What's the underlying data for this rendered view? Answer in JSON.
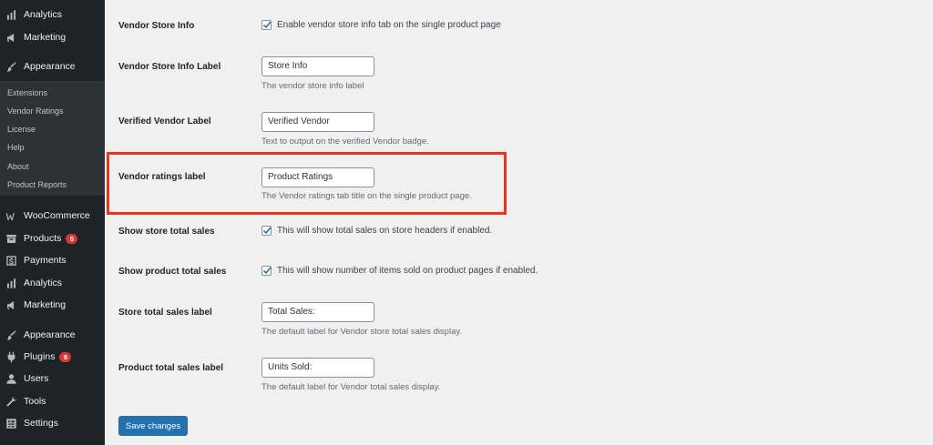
{
  "sidebar": {
    "items": [
      {
        "label": "Analytics",
        "icon": "analytics-icon"
      },
      {
        "label": "Marketing",
        "icon": "megaphone-icon"
      },
      {
        "label": "Appearance",
        "icon": "paintbrush-icon"
      },
      {
        "label": "WooCommerce",
        "icon": "woocommerce-icon"
      },
      {
        "label": "Products",
        "icon": "archive-icon",
        "badge": "5"
      },
      {
        "label": "Payments",
        "icon": "dollar-icon"
      },
      {
        "label": "Analytics",
        "icon": "analytics-icon"
      },
      {
        "label": "Marketing",
        "icon": "megaphone-icon"
      },
      {
        "label": "Appearance",
        "icon": "paintbrush-icon"
      },
      {
        "label": "Plugins",
        "icon": "plugin-icon",
        "badge": "8"
      },
      {
        "label": "Users",
        "icon": "users-icon"
      },
      {
        "label": "Tools",
        "icon": "wrench-icon"
      },
      {
        "label": "Settings",
        "icon": "settings-icon"
      }
    ],
    "submenu": [
      "Extensions",
      "Vendor Ratings",
      "License",
      "Help",
      "About",
      "Product Reports"
    ]
  },
  "settings": {
    "vendor_store_info": {
      "label": "Vendor Store Info",
      "checkbox_text": "Enable vendor store info tab on the single product page",
      "checked": true
    },
    "vendor_store_info_label": {
      "label": "Vendor Store Info Label",
      "value": "Store Info",
      "description": "The vendor store info label"
    },
    "verified_vendor_label": {
      "label": "Verified Vendor Label",
      "value": "Verified Vendor",
      "description": "Text to output on the verified Vendor badge."
    },
    "vendor_ratings_label": {
      "label": "Vendor ratings label",
      "value": "Product Ratings",
      "description": "The Vendor ratings tab title on the single product page."
    },
    "show_store_total_sales": {
      "label": "Show store total sales",
      "checkbox_text": "This will show total sales on store headers if enabled.",
      "checked": true
    },
    "show_product_total_sales": {
      "label": "Show product total sales",
      "checkbox_text": "This will show number of items sold on product pages if enabled.",
      "checked": true
    },
    "store_total_sales_label": {
      "label": "Store total sales label",
      "value": "Total Sales:",
      "description": "The default label for Vendor store total sales display."
    },
    "product_total_sales_label": {
      "label": "Product total sales label",
      "value": "Units Sold:",
      "description": "The default label for Vendor total sales display."
    }
  },
  "save_button_label": "Save changes",
  "colors": {
    "sidebar_bg": "#1d2327",
    "submenu_bg": "#2c3338",
    "badge": "#d63638",
    "primary_button": "#2271b1",
    "highlight_border": "#e6361f",
    "checkbox_check": "#2271b1"
  }
}
